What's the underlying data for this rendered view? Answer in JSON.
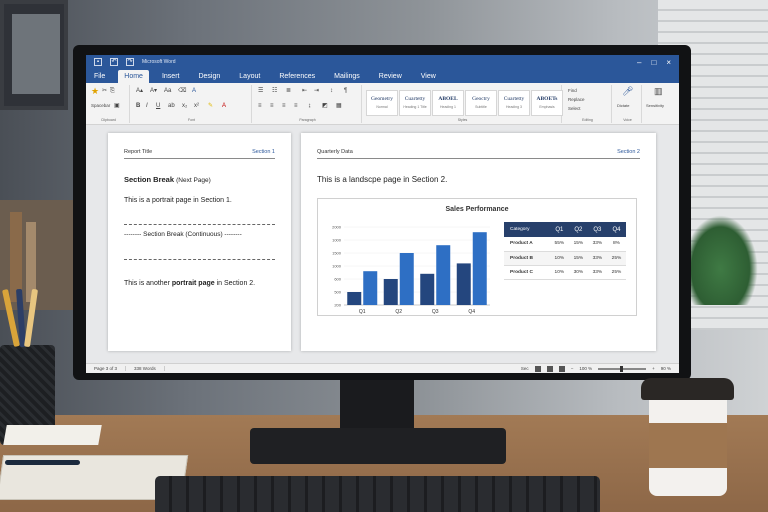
{
  "titlebar": {
    "filename": "Microsoft Word",
    "controls": [
      "–",
      "□",
      "×"
    ]
  },
  "tabs": [
    "File",
    "Home",
    "Insert",
    "Design",
    "Layout",
    "References",
    "Mailings",
    "Review",
    "View"
  ],
  "active_tab": "Home",
  "ribbon": {
    "group_labels": [
      "Clipboard",
      "Font",
      "Paragraph",
      "Styles",
      "Editing",
      "Voice",
      "Sensitivity"
    ],
    "paste_label": "Spacebar",
    "styles": [
      {
        "name": "Geometry",
        "sub": "Normal"
      },
      {
        "name": "Cuartetty",
        "sub": "Heading 1 Title"
      },
      {
        "name": "ABOEL",
        "sub": "Heading 1"
      },
      {
        "name": "Geoctry",
        "sub": "Subtitle"
      },
      {
        "name": "Cuartetty",
        "sub": "Heading 3"
      },
      {
        "name": "ABOETs",
        "sub": "Emphasis"
      }
    ],
    "editing": [
      "Find",
      "Replace",
      "Select"
    ],
    "voice_label": "Dictate",
    "sens_label": "Sensitivity"
  },
  "page1": {
    "header_left": "Report Title",
    "header_right": "Section 1",
    "break_bold": "Section Break",
    "break_rest": "(Next Page)",
    "para1": "This is a portrait page in Section 1.",
    "cont_break": "-------- Section Break (Continuous) --------",
    "para2_start": "This is another ",
    "para2_bold": "portrait page",
    "para2_end": " in Section 2."
  },
  "page2": {
    "header_left": "Quarterly Data",
    "header_right": "Section 2",
    "para": "This is a landscpe page in Section 2."
  },
  "chart_data": {
    "type": "bar",
    "title": "Sales Performance",
    "categories": [
      "Q1",
      "Q2",
      "Q3",
      "Q4"
    ],
    "y_ticks": [
      "2000",
      "1000",
      "1500",
      "1000",
      "600",
      "500",
      "200"
    ],
    "series": [
      {
        "values": [
          250,
          500,
          600,
          800
        ],
        "color": "#24467e"
      },
      {
        "values": [
          650,
          1000,
          1150,
          1400
        ],
        "color": "#2e6fc4"
      }
    ],
    "ylim": [
      0,
      1500
    ]
  },
  "table": {
    "headers": [
      "Category",
      "Q1",
      "Q2",
      "Q3",
      "Q4"
    ],
    "rows": [
      [
        "Product A",
        "55%",
        "15%",
        "33%",
        "8%"
      ],
      [
        "Product B",
        "10%",
        "15%",
        "33%",
        "25%"
      ],
      [
        "Product C",
        "10%",
        "30%",
        "33%",
        "25%"
      ]
    ]
  },
  "status": {
    "page": "Page 3 of 3",
    "words": "338 Words",
    "view_label": "Sec",
    "zoom": "100 %",
    "zoom_right": "90 %"
  },
  "colors": {
    "accent": "#2b579a",
    "bar_dark": "#24467e",
    "bar_light": "#2e6fc4",
    "table_header": "#27406b"
  }
}
